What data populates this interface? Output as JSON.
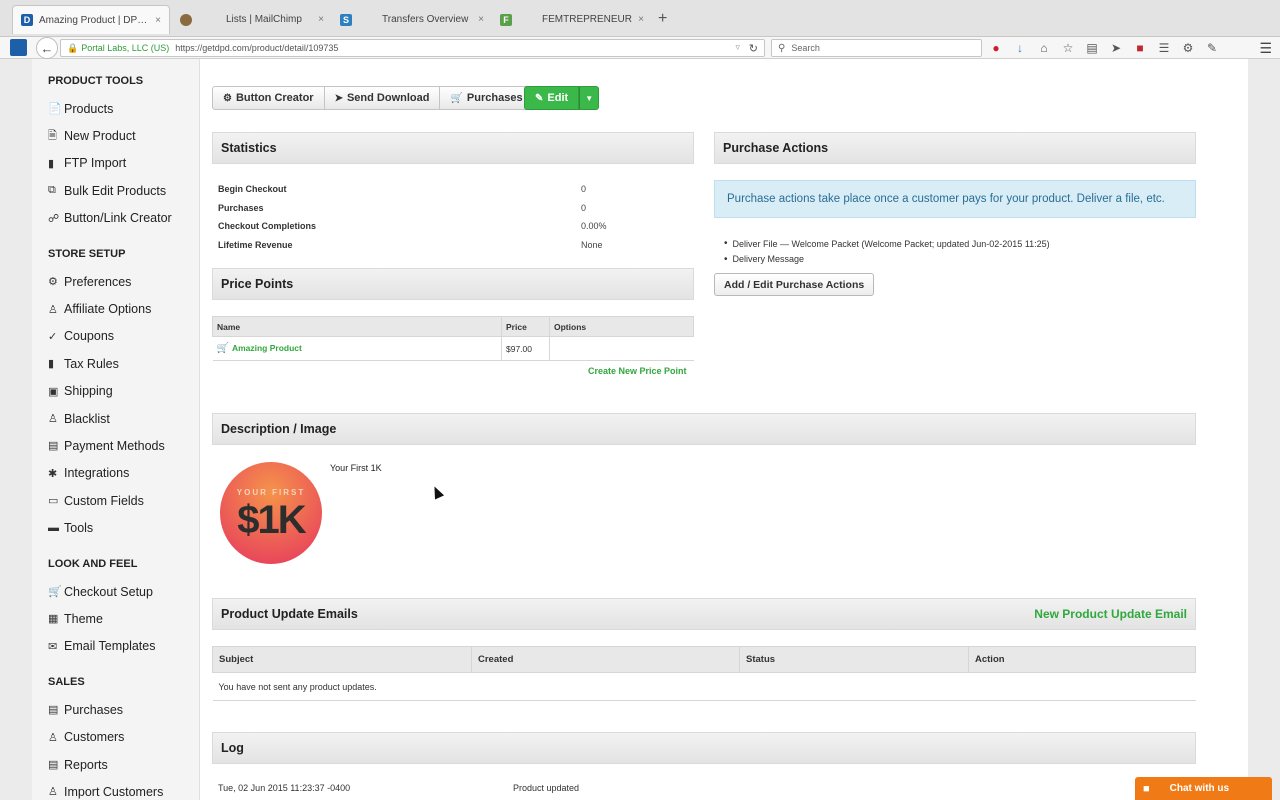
{
  "browser": {
    "tabs": [
      {
        "label": "Amazing Product | DPD Sho...",
        "close": "×",
        "favicon_color": "#1d5fa8",
        "favicon_glyph": "D"
      },
      {
        "label": "Lists | MailChimp",
        "close": "×",
        "favicon_color": "#8a6a3f",
        "favicon_glyph": "●"
      },
      {
        "label": "Transfers Overview",
        "close": "×",
        "favicon_color": "#2d7fc1",
        "favicon_glyph": "S"
      },
      {
        "label": "FEMTREPRENEUR",
        "close": "×",
        "favicon_color": "#5aa04a",
        "favicon_glyph": "F"
      }
    ],
    "new_tab": "+",
    "address": {
      "org": "Portal Labs, LLC (US)",
      "url": "https://getdpd.com/product/detail/109735"
    },
    "search_placeholder": "Search"
  },
  "sidebar": {
    "sections": [
      {
        "title": "PRODUCT TOOLS",
        "items": [
          {
            "label": "Products",
            "icon": "file-icon"
          },
          {
            "label": "New Product",
            "icon": "file-plus-icon"
          },
          {
            "label": "FTP Import",
            "icon": "folder-icon"
          },
          {
            "label": "Bulk Edit Products",
            "icon": "copy-icon"
          },
          {
            "label": "Button/Link Creator",
            "icon": "link-icon"
          }
        ]
      },
      {
        "title": "STORE SETUP",
        "items": [
          {
            "label": "Preferences",
            "icon": "gears-icon"
          },
          {
            "label": "Affiliate Options",
            "icon": "users-icon"
          },
          {
            "label": "Coupons",
            "icon": "tag-icon"
          },
          {
            "label": "Tax Rules",
            "icon": "book-icon"
          },
          {
            "label": "Shipping",
            "icon": "truck-icon"
          },
          {
            "label": "Blacklist",
            "icon": "user-block-icon"
          },
          {
            "label": "Payment Methods",
            "icon": "credit-card-icon"
          },
          {
            "label": "Integrations",
            "icon": "puzzle-icon"
          },
          {
            "label": "Custom Fields",
            "icon": "input-field-icon"
          },
          {
            "label": "Tools",
            "icon": "toolbox-icon"
          }
        ]
      },
      {
        "title": "LOOK AND FEEL",
        "items": [
          {
            "label": "Checkout Setup",
            "icon": "cart-icon"
          },
          {
            "label": "Theme",
            "icon": "theme-icon"
          },
          {
            "label": "Email Templates",
            "icon": "envelope-icon"
          }
        ]
      },
      {
        "title": "SALES",
        "items": [
          {
            "label": "Purchases",
            "icon": "receipt-icon"
          },
          {
            "label": "Customers",
            "icon": "user-icon"
          },
          {
            "label": "Reports",
            "icon": "chart-icon"
          },
          {
            "label": "Import Customers",
            "icon": "user-import-icon"
          }
        ]
      }
    ]
  },
  "toolbar": {
    "button_creator": "Button Creator",
    "send_download": "Send Download",
    "purchases": "Purchases",
    "edit": "Edit"
  },
  "statistics": {
    "title": "Statistics",
    "rows": [
      {
        "label": "Begin Checkout",
        "value": "0"
      },
      {
        "label": "Purchases",
        "value": "0"
      },
      {
        "label": "Checkout Completions",
        "value": "0.00%"
      },
      {
        "label": "Lifetime Revenue",
        "value": "None"
      }
    ]
  },
  "price_points": {
    "title": "Price Points",
    "columns": [
      "Name",
      "Price",
      "Options"
    ],
    "rows": [
      {
        "name": "Amazing Product",
        "price": "$97.00",
        "options": ""
      }
    ],
    "create_link": "Create New Price Point"
  },
  "purchase_actions": {
    "title": "Purchase Actions",
    "info": "Purchase actions take place once a customer pays for your product. Deliver a file, etc.",
    "items": [
      "Deliver File — Welcome Packet (Welcome Packet; updated Jun-02-2015 11:25)",
      "Delivery Message"
    ],
    "button": "Add / Edit Purchase Actions"
  },
  "description": {
    "title": "Description / Image",
    "text": "Your First 1K",
    "image_top": "YOUR FIRST",
    "image_main": "$1K"
  },
  "product_update_emails": {
    "title": "Product Update Emails",
    "new_link": "New Product Update Email",
    "columns": [
      "Subject",
      "Created",
      "Status",
      "Action"
    ],
    "empty": "You have not sent any product updates."
  },
  "log": {
    "title": "Log",
    "rows": [
      {
        "timestamp": "Tue, 02 Jun 2015 11:23:37 -0400",
        "message": "Product updated"
      }
    ]
  },
  "chat": {
    "label": "Chat with us"
  },
  "colors": {
    "accent_green": "#3bb84a",
    "info_blue": "#d9edf7",
    "chat_orange": "#ef7a16"
  }
}
